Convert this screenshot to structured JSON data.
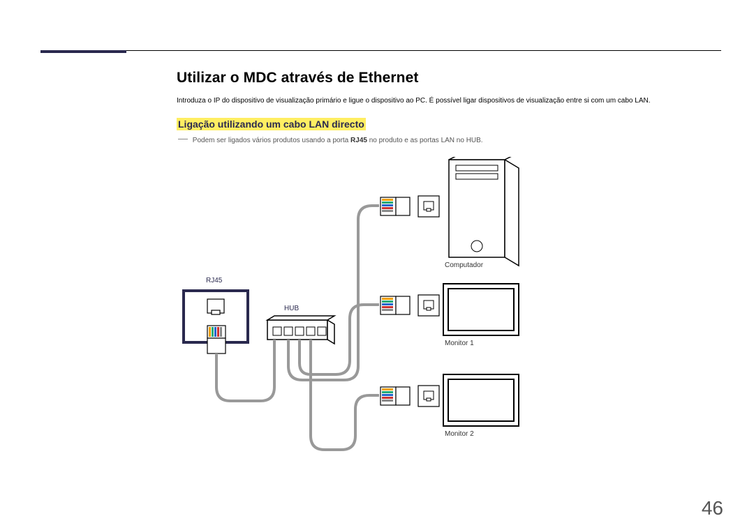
{
  "header": {
    "title": "Utilizar o MDC através de Ethernet",
    "intro": "Introduza o IP do dispositivo de visualização primário e ligue o dispositivo ao PC. É possível ligar dispositivos de visualização entre si com um cabo LAN.",
    "subheading": "Ligação utilizando um cabo LAN directo"
  },
  "note": {
    "prefix": "Podem ser ligados vários produtos usando a porta ",
    "bold": "RJ45",
    "suffix": " no produto e as portas LAN no HUB."
  },
  "diagram": {
    "labels": {
      "rj45": "RJ45",
      "hub": "HUB",
      "computer": "Computador",
      "monitor1": "Monitor 1",
      "monitor2": "Monitor 2"
    }
  },
  "page_number": "46"
}
